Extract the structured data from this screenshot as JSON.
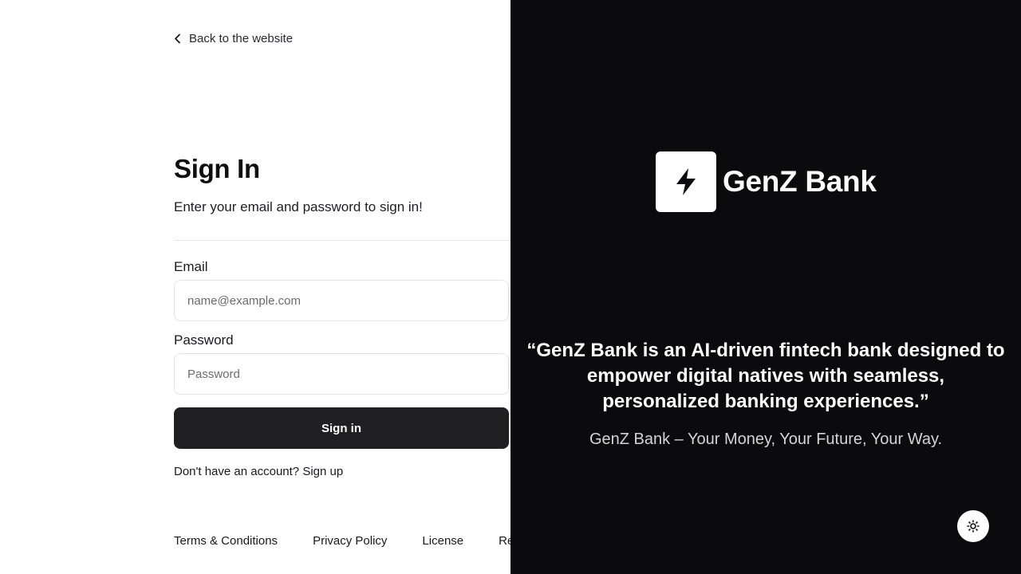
{
  "nav": {
    "back_label": "Back to the website",
    "back_icon": "chevron-left-icon"
  },
  "form": {
    "title": "Sign In",
    "subtitle": "Enter your email and password to sign in!",
    "email_label": "Email",
    "email_placeholder": "name@example.com",
    "email_value": "",
    "password_label": "Password",
    "password_placeholder": "Password",
    "password_value": "",
    "submit_label": "Sign in",
    "signup_prompt": "Don't have an account?",
    "signup_link": "Sign up"
  },
  "footer": {
    "links": [
      "Terms & Conditions",
      "Privacy Policy",
      "License",
      "Re"
    ]
  },
  "brand": {
    "name": "GenZ Bank",
    "logo_icon": "lightning-bolt-icon",
    "quote": "“GenZ Bank is an AI-driven fintech bank designed to empower digital natives with seamless, personalized banking experiences.”",
    "tagline": "GenZ Bank – Your Money, Your Future, Your Way."
  },
  "theme_toggle": {
    "icon": "sun-icon"
  },
  "colors": {
    "panel_dark": "#0b0b0d",
    "button_dark": "#202022",
    "border": "#e4e4e7",
    "white": "#ffffff"
  }
}
